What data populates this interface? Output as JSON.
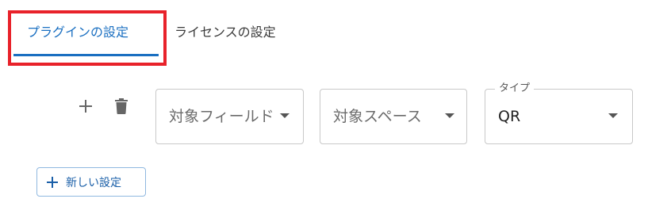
{
  "tabs": [
    {
      "label": "プラグインの設定",
      "active": true
    },
    {
      "label": "ライセンスの設定",
      "active": false
    }
  ],
  "toolbar": {
    "add_icon": "plus-icon",
    "delete_icon": "trash-icon"
  },
  "fields": {
    "target_field": {
      "placeholder": "対象フィールド"
    },
    "target_space": {
      "placeholder": "対象スペース"
    },
    "type": {
      "label": "タイプ",
      "value": "QR"
    }
  },
  "new_setting_button": {
    "label": "新しい設定",
    "icon": "plus-icon"
  },
  "colors": {
    "accent": "#1a6fc1",
    "highlight": "#e8222a",
    "border": "#c8c8c8"
  }
}
